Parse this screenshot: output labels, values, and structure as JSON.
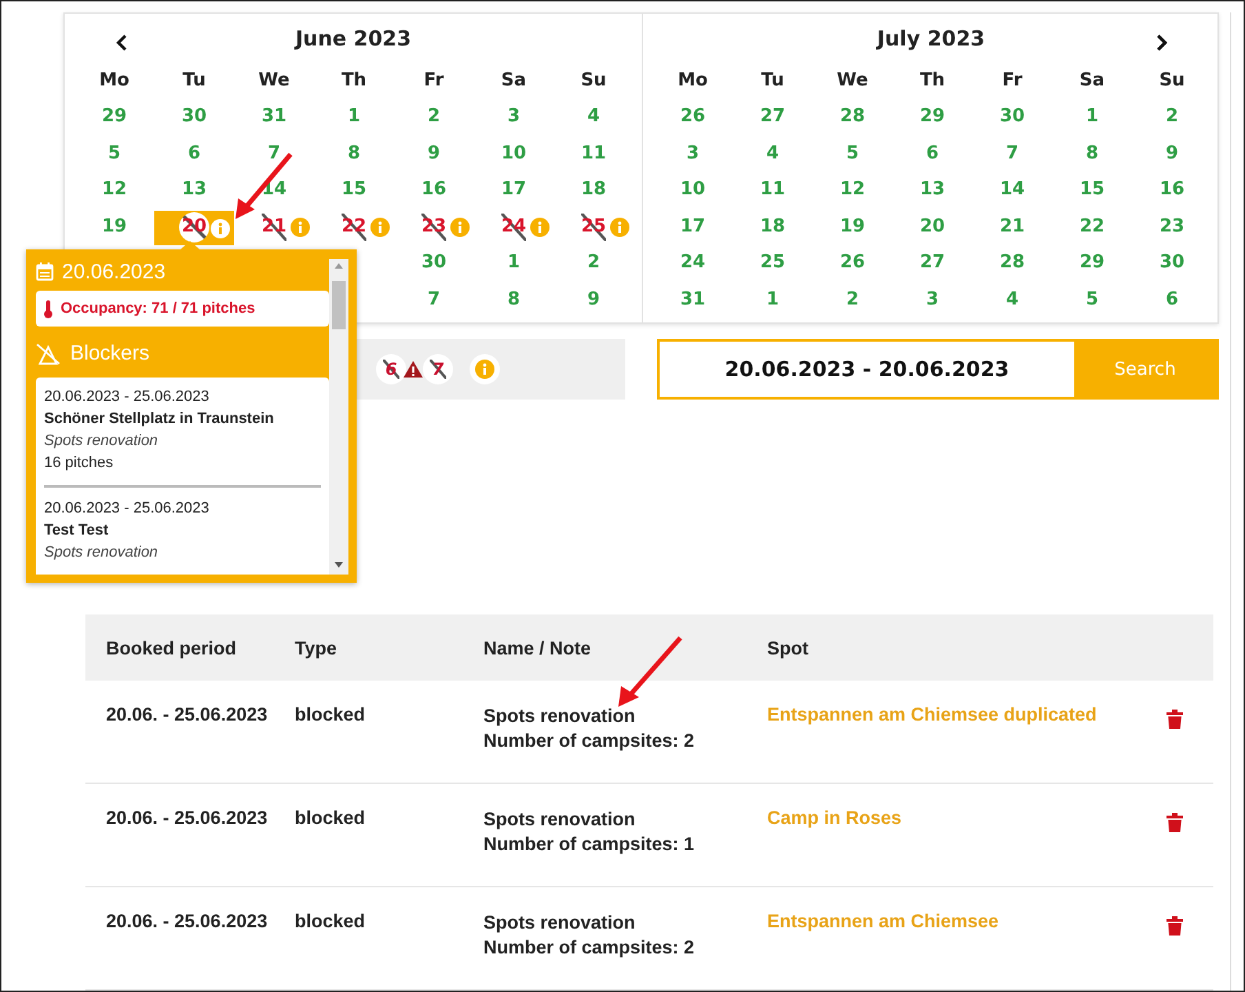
{
  "calendar": {
    "months": [
      {
        "title": "June 2023",
        "weekdays": [
          "Mo",
          "Tu",
          "We",
          "Th",
          "Fr",
          "Sa",
          "Su"
        ],
        "weeks": [
          [
            {
              "day": "29",
              "selected": false,
              "blocked": false,
              "info": false
            },
            {
              "day": "30",
              "selected": false,
              "blocked": false,
              "info": false
            },
            {
              "day": "31",
              "selected": false,
              "blocked": false,
              "info": false
            },
            {
              "day": "1",
              "selected": false,
              "blocked": false,
              "info": false
            },
            {
              "day": "2",
              "selected": false,
              "blocked": false,
              "info": false
            },
            {
              "day": "3",
              "selected": false,
              "blocked": false,
              "info": false
            },
            {
              "day": "4",
              "selected": false,
              "blocked": false,
              "info": false
            }
          ],
          [
            {
              "day": "5",
              "selected": false,
              "blocked": false,
              "info": false
            },
            {
              "day": "6",
              "selected": false,
              "blocked": false,
              "info": false
            },
            {
              "day": "7",
              "selected": false,
              "blocked": false,
              "info": false
            },
            {
              "day": "8",
              "selected": false,
              "blocked": false,
              "info": false
            },
            {
              "day": "9",
              "selected": false,
              "blocked": false,
              "info": false
            },
            {
              "day": "10",
              "selected": false,
              "blocked": false,
              "info": false
            },
            {
              "day": "11",
              "selected": false,
              "blocked": false,
              "info": false
            }
          ],
          [
            {
              "day": "12",
              "selected": false,
              "blocked": false,
              "info": false
            },
            {
              "day": "13",
              "selected": false,
              "blocked": false,
              "info": false
            },
            {
              "day": "14",
              "selected": false,
              "blocked": false,
              "info": false
            },
            {
              "day": "15",
              "selected": false,
              "blocked": false,
              "info": false
            },
            {
              "day": "16",
              "selected": false,
              "blocked": false,
              "info": false
            },
            {
              "day": "17",
              "selected": false,
              "blocked": false,
              "info": false
            },
            {
              "day": "18",
              "selected": false,
              "blocked": false,
              "info": false
            }
          ],
          [
            {
              "day": "19",
              "selected": false,
              "blocked": false,
              "info": false
            },
            {
              "day": "20",
              "selected": true,
              "blocked": true,
              "info": true
            },
            {
              "day": "21",
              "selected": false,
              "blocked": true,
              "info": true
            },
            {
              "day": "22",
              "selected": false,
              "blocked": true,
              "info": true
            },
            {
              "day": "23",
              "selected": false,
              "blocked": true,
              "info": true
            },
            {
              "day": "24",
              "selected": false,
              "blocked": true,
              "info": true
            },
            {
              "day": "25",
              "selected": false,
              "blocked": true,
              "info": true
            }
          ],
          [
            {
              "day": "30",
              "selected": false,
              "blocked": false,
              "info": false
            },
            {
              "day": "1",
              "selected": false,
              "blocked": false,
              "info": false
            },
            {
              "day": "2",
              "selected": false,
              "blocked": false,
              "info": false
            }
          ],
          [
            {
              "day": "7",
              "selected": false,
              "blocked": false,
              "info": false
            },
            {
              "day": "8",
              "selected": false,
              "blocked": false,
              "info": false
            },
            {
              "day": "9",
              "selected": false,
              "blocked": false,
              "info": false
            }
          ]
        ]
      },
      {
        "title": "July 2023",
        "weekdays": [
          "Mo",
          "Tu",
          "We",
          "Th",
          "Fr",
          "Sa",
          "Su"
        ],
        "weeks": [
          [
            {
              "day": "26",
              "selected": false,
              "blocked": false,
              "info": false
            },
            {
              "day": "27",
              "selected": false,
              "blocked": false,
              "info": false
            },
            {
              "day": "28",
              "selected": false,
              "blocked": false,
              "info": false
            },
            {
              "day": "29",
              "selected": false,
              "blocked": false,
              "info": false
            },
            {
              "day": "30",
              "selected": false,
              "blocked": false,
              "info": false
            },
            {
              "day": "1",
              "selected": false,
              "blocked": false,
              "info": false
            },
            {
              "day": "2",
              "selected": false,
              "blocked": false,
              "info": false
            }
          ],
          [
            {
              "day": "3",
              "selected": false,
              "blocked": false,
              "info": false
            },
            {
              "day": "4",
              "selected": false,
              "blocked": false,
              "info": false
            },
            {
              "day": "5",
              "selected": false,
              "blocked": false,
              "info": false
            },
            {
              "day": "6",
              "selected": false,
              "blocked": false,
              "info": false
            },
            {
              "day": "7",
              "selected": false,
              "blocked": false,
              "info": false
            },
            {
              "day": "8",
              "selected": false,
              "blocked": false,
              "info": false
            },
            {
              "day": "9",
              "selected": false,
              "blocked": false,
              "info": false
            }
          ],
          [
            {
              "day": "10",
              "selected": false,
              "blocked": false,
              "info": false
            },
            {
              "day": "11",
              "selected": false,
              "blocked": false,
              "info": false
            },
            {
              "day": "12",
              "selected": false,
              "blocked": false,
              "info": false
            },
            {
              "day": "13",
              "selected": false,
              "blocked": false,
              "info": false
            },
            {
              "day": "14",
              "selected": false,
              "blocked": false,
              "info": false
            },
            {
              "day": "15",
              "selected": false,
              "blocked": false,
              "info": false
            },
            {
              "day": "16",
              "selected": false,
              "blocked": false,
              "info": false
            }
          ],
          [
            {
              "day": "17",
              "selected": false,
              "blocked": false,
              "info": false
            },
            {
              "day": "18",
              "selected": false,
              "blocked": false,
              "info": false
            },
            {
              "day": "19",
              "selected": false,
              "blocked": false,
              "info": false
            },
            {
              "day": "20",
              "selected": false,
              "blocked": false,
              "info": false
            },
            {
              "day": "21",
              "selected": false,
              "blocked": false,
              "info": false
            },
            {
              "day": "22",
              "selected": false,
              "blocked": false,
              "info": false
            },
            {
              "day": "23",
              "selected": false,
              "blocked": false,
              "info": false
            }
          ],
          [
            {
              "day": "24",
              "selected": false,
              "blocked": false,
              "info": false
            },
            {
              "day": "25",
              "selected": false,
              "blocked": false,
              "info": false
            },
            {
              "day": "26",
              "selected": false,
              "blocked": false,
              "info": false
            },
            {
              "day": "27",
              "selected": false,
              "blocked": false,
              "info": false
            },
            {
              "day": "28",
              "selected": false,
              "blocked": false,
              "info": false
            },
            {
              "day": "29",
              "selected": false,
              "blocked": false,
              "info": false
            },
            {
              "day": "30",
              "selected": false,
              "blocked": false,
              "info": false
            }
          ],
          [
            {
              "day": "31",
              "selected": false,
              "blocked": false,
              "info": false
            },
            {
              "day": "1",
              "selected": false,
              "blocked": false,
              "info": false
            },
            {
              "day": "2",
              "selected": false,
              "blocked": false,
              "info": false
            },
            {
              "day": "3",
              "selected": false,
              "blocked": false,
              "info": false
            },
            {
              "day": "4",
              "selected": false,
              "blocked": false,
              "info": false
            },
            {
              "day": "5",
              "selected": false,
              "blocked": false,
              "info": false
            },
            {
              "day": "6",
              "selected": false,
              "blocked": false,
              "info": false
            }
          ]
        ]
      }
    ]
  },
  "legend": [
    {
      "kind": "blocked",
      "label": "6"
    },
    {
      "kind": "warning",
      "label": "7"
    },
    {
      "kind": "info"
    }
  ],
  "search": {
    "value": "20.06.2023 - 20.06.2023",
    "button": "Search"
  },
  "popover": {
    "date": "20.06.2023",
    "occupancy": "Occupancy: 71 / 71 pitches",
    "title": "Blockers",
    "blockers": [
      {
        "period": "20.06.2023 - 25.06.2023",
        "name": "Schöner Stellplatz in Traunstein",
        "note": "Spots renovation",
        "pitches": "16 pitches"
      },
      {
        "period": "20.06.2023 - 25.06.2023",
        "name": "Test Test",
        "note": "Spots renovation"
      }
    ]
  },
  "table": {
    "columns": [
      "Booked period",
      "Type",
      "Name / Note",
      "Spot"
    ],
    "rows": [
      {
        "period": "20.06. - 25.06.2023",
        "type": "blocked",
        "name": "Spots renovation",
        "note": "Number of campsites: 2",
        "spot": "Entspannen am Chiemsee duplicated"
      },
      {
        "period": "20.06. - 25.06.2023",
        "type": "blocked",
        "name": "Spots renovation",
        "note": "Number of campsites: 1",
        "spot": "Camp in Roses"
      },
      {
        "period": "20.06. - 25.06.2023",
        "type": "blocked",
        "name": "Spots renovation",
        "note": "Number of campsites: 2",
        "spot": "Entspannen am Chiemsee"
      }
    ]
  }
}
